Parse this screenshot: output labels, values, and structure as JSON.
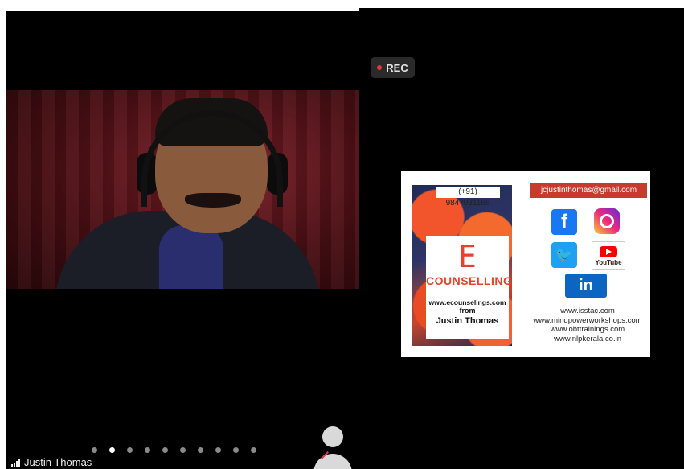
{
  "recording": {
    "label": "REC",
    "dot_color": "#e03a3a"
  },
  "participant": {
    "name": "Justin Thomas"
  },
  "slide": {
    "phone": "(+91) 9847031166",
    "email": "jcjustinthomas@gmail.com",
    "brand_letter": "E",
    "brand_word": "COUNSELLING",
    "url": "www.ecounselings.com",
    "from": "from",
    "author": "Justin Thomas",
    "social": {
      "facebook": "f",
      "twitter": "🐦",
      "youtube": "YouTube",
      "linkedin": "in"
    },
    "websites": [
      "www.isstac.com",
      "www.mindpowerworkshops.com",
      "www.obttrainings.com",
      "www.nlpkerala.co.in"
    ]
  },
  "pagination": {
    "total": 10,
    "active": 2
  }
}
